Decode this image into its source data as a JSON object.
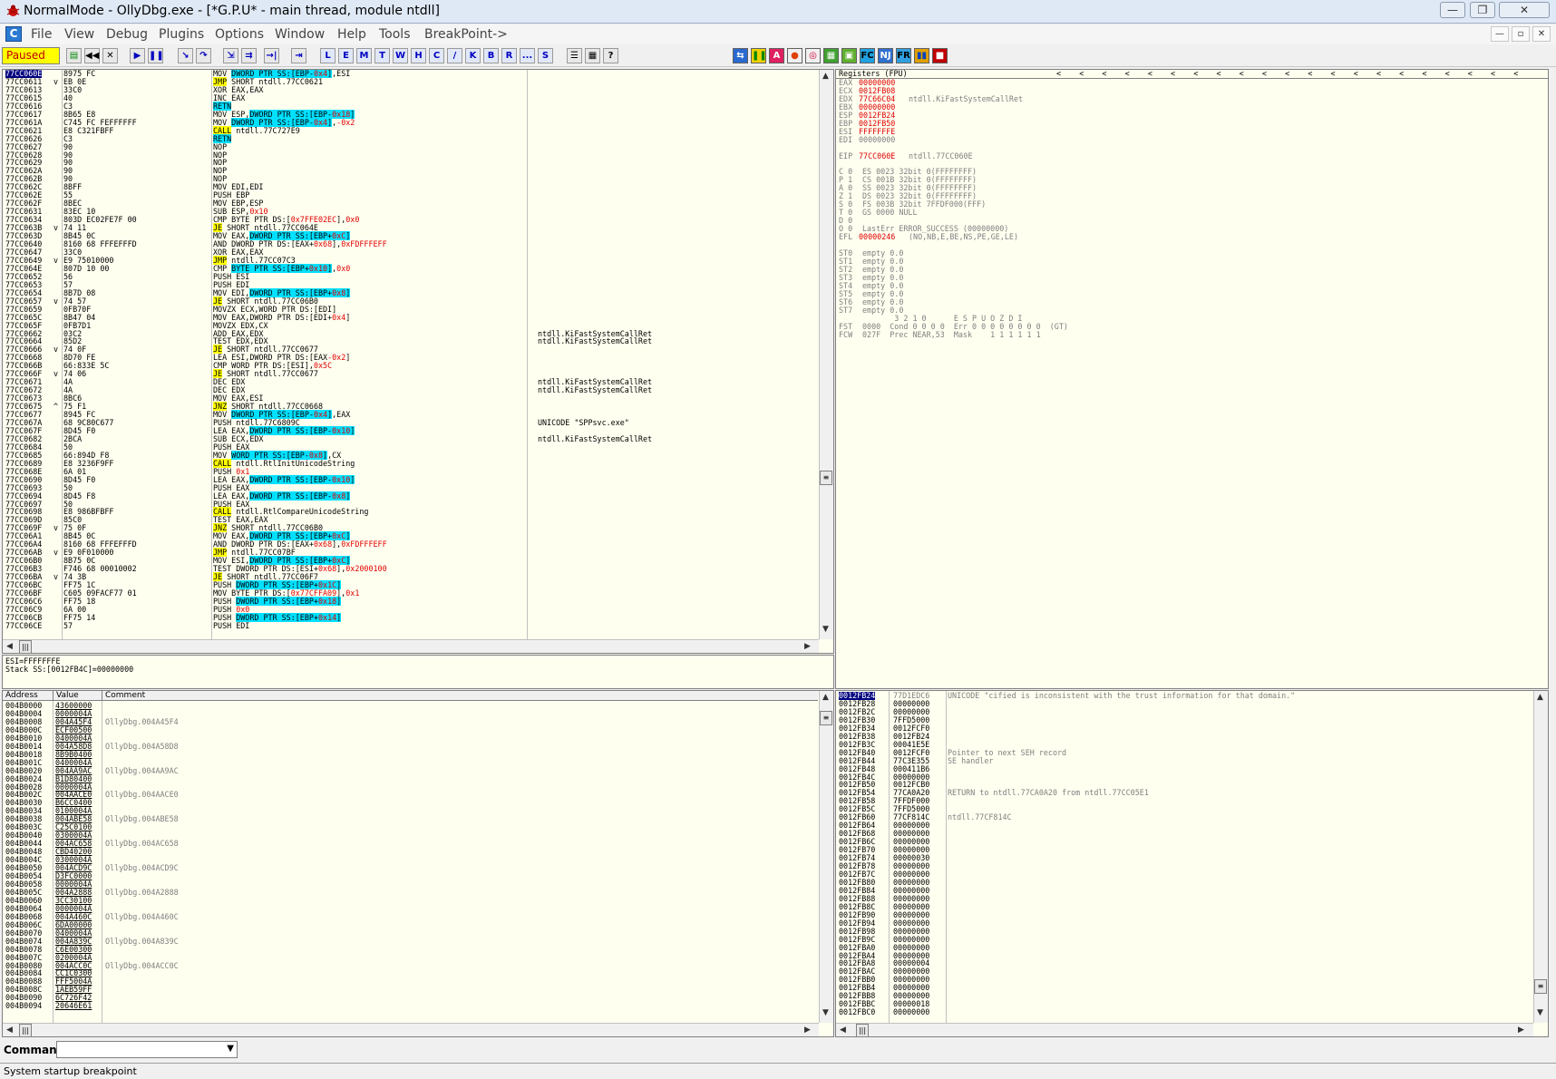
{
  "window": {
    "title": "NormalMode - OllyDbg.exe - [*G.P.U* - main thread, module ntdll]",
    "min_label": "—",
    "max_label": "❐",
    "close_label": "✕"
  },
  "menu": {
    "items": [
      "File",
      "View",
      "Debug",
      "Plugins",
      "Options",
      "Window",
      "Help",
      "Tools",
      "BreakPoint->"
    ],
    "icon_label": "C",
    "mdi_min": "—",
    "mdi_restore": "▫",
    "mdi_close": "✕"
  },
  "toolbar": {
    "status": "Paused",
    "letters": [
      "L",
      "E",
      "M",
      "T",
      "W",
      "H",
      "C",
      "/",
      "K",
      "B",
      "R",
      "...",
      "S"
    ]
  },
  "disasm": {
    "rows": [
      [
        "77CC060E",
        "8975 FC",
        "",
        "MOV DWORD PTR SS:[EBP-0x4],ESI",
        ""
      ],
      [
        "77CC0611",
        "EB 0E",
        "v",
        "JMP SHORT ntdll.77CC0621",
        ""
      ],
      [
        "77CC0613",
        "33C0",
        "",
        "XOR EAX,EAX",
        ""
      ],
      [
        "77CC0615",
        "40",
        "",
        "INC EAX",
        ""
      ],
      [
        "77CC0616",
        "C3",
        "",
        "RETN",
        ""
      ],
      [
        "77CC0617",
        "8B65 E8",
        "",
        "MOV ESP,DWORD PTR SS:[EBP-0x18]",
        ""
      ],
      [
        "77CC061A",
        "C745 FC FEFFFFFF",
        "",
        "MOV DWORD PTR SS:[EBP-0x4],-0x2",
        ""
      ],
      [
        "77CC0621",
        "E8 C321FBFF",
        "",
        "CALL ntdll.77C727E9",
        ""
      ],
      [
        "77CC0626",
        "C3",
        "",
        "RETN",
        ""
      ],
      [
        "77CC0627",
        "90",
        "",
        "NOP",
        ""
      ],
      [
        "77CC0628",
        "90",
        "",
        "NOP",
        ""
      ],
      [
        "77CC0629",
        "90",
        "",
        "NOP",
        ""
      ],
      [
        "77CC062A",
        "90",
        "",
        "NOP",
        ""
      ],
      [
        "77CC062B",
        "90",
        "",
        "NOP",
        ""
      ],
      [
        "77CC062C",
        "8BFF",
        "",
        "MOV EDI,EDI",
        ""
      ],
      [
        "77CC062E",
        "55",
        "",
        "PUSH EBP",
        ""
      ],
      [
        "77CC062F",
        "8BEC",
        "",
        "MOV EBP,ESP",
        ""
      ],
      [
        "77CC0631",
        "83EC 10",
        "",
        "SUB ESP,0x10",
        ""
      ],
      [
        "77CC0634",
        "803D EC02FE7F 00",
        "",
        "CMP BYTE PTR DS:[0x7FFE02EC],0x0",
        ""
      ],
      [
        "77CC063B",
        "74 11",
        "v",
        "JE SHORT ntdll.77CC064E",
        ""
      ],
      [
        "77CC063D",
        "8B45 0C",
        "",
        "MOV EAX,DWORD PTR SS:[EBP+0xC]",
        ""
      ],
      [
        "77CC0640",
        "8160 68 FFFEFFFD",
        "",
        "AND DWORD PTR DS:[EAX+0x68],0xFDFFFEFF",
        ""
      ],
      [
        "77CC0647",
        "33C0",
        "",
        "XOR EAX,EAX",
        ""
      ],
      [
        "77CC0649",
        "E9 75010000",
        "v",
        "JMP ntdll.77CC07C3",
        ""
      ],
      [
        "77CC064E",
        "807D 10 00",
        "",
        "CMP BYTE PTR SS:[EBP+0x10],0x0",
        ""
      ],
      [
        "77CC0652",
        "56",
        "",
        "PUSH ESI",
        ""
      ],
      [
        "77CC0653",
        "57",
        "",
        "PUSH EDI",
        ""
      ],
      [
        "77CC0654",
        "8B7D 08",
        "",
        "MOV EDI,DWORD PTR SS:[EBP+0x8]",
        ""
      ],
      [
        "77CC0657",
        "74 57",
        "v",
        "JE SHORT ntdll.77CC06B0",
        ""
      ],
      [
        "77CC0659",
        "0FB70F",
        "",
        "MOVZX ECX,WORD PTR DS:[EDI]",
        ""
      ],
      [
        "77CC065C",
        "8B47 04",
        "",
        "MOV EAX,DWORD PTR DS:[EDI+0x4]",
        ""
      ],
      [
        "77CC065F",
        "0FB7D1",
        "",
        "MOVZX EDX,CX",
        ""
      ],
      [
        "77CC0662",
        "03C2",
        "",
        "ADD EAX,EDX",
        "ntdll.KiFastSystemCallRet"
      ],
      [
        "77CC0664",
        "85D2",
        "",
        "TEST EDX,EDX",
        "ntdll.KiFastSystemCallRet"
      ],
      [
        "77CC0666",
        "74 0F",
        "v",
        "JE SHORT ntdll.77CC0677",
        ""
      ],
      [
        "77CC0668",
        "8D70 FE",
        "",
        "LEA ESI,DWORD PTR DS:[EAX-0x2]",
        ""
      ],
      [
        "77CC066B",
        "66:833E 5C",
        "",
        "CMP WORD PTR DS:[ESI],0x5C",
        ""
      ],
      [
        "77CC066F",
        "74 06",
        "v",
        "JE SHORT ntdll.77CC0677",
        ""
      ],
      [
        "77CC0671",
        "4A",
        "",
        "DEC EDX",
        "ntdll.KiFastSystemCallRet"
      ],
      [
        "77CC0672",
        "4A",
        "",
        "DEC EDX",
        "ntdll.KiFastSystemCallRet"
      ],
      [
        "77CC0673",
        "8BC6",
        "",
        "MOV EAX,ESI",
        ""
      ],
      [
        "77CC0675",
        "75 F1",
        "^",
        "JNZ SHORT ntdll.77CC0668",
        ""
      ],
      [
        "77CC0677",
        "8945 FC",
        "",
        "MOV DWORD PTR SS:[EBP-0x4],EAX",
        ""
      ],
      [
        "77CC067A",
        "68 9C80C677",
        "",
        "PUSH ntdll.77C6809C",
        "UNICODE \"SPPsvc.exe\""
      ],
      [
        "77CC067F",
        "8D45 F0",
        "",
        "LEA EAX,DWORD PTR SS:[EBP-0x10]",
        ""
      ],
      [
        "77CC0682",
        "2BCA",
        "",
        "SUB ECX,EDX",
        "ntdll.KiFastSystemCallRet"
      ],
      [
        "77CC0684",
        "50",
        "",
        "PUSH EAX",
        ""
      ],
      [
        "77CC0685",
        "66:894D F8",
        "",
        "MOV WORD PTR SS:[EBP-0x8],CX",
        ""
      ],
      [
        "77CC0689",
        "E8 3236F9FF",
        "",
        "CALL ntdll.RtlInitUnicodeString",
        ""
      ],
      [
        "77CC068E",
        "6A 01",
        "",
        "PUSH 0x1",
        ""
      ],
      [
        "77CC0690",
        "8D45 F0",
        "",
        "LEA EAX,DWORD PTR SS:[EBP-0x10]",
        ""
      ],
      [
        "77CC0693",
        "50",
        "",
        "PUSH EAX",
        ""
      ],
      [
        "77CC0694",
        "8D45 F8",
        "",
        "LEA EAX,DWORD PTR SS:[EBP-0x8]",
        ""
      ],
      [
        "77CC0697",
        "50",
        "",
        "PUSH EAX",
        ""
      ],
      [
        "77CC0698",
        "E8 986BFBFF",
        "",
        "CALL ntdll.RtlCompareUnicodeString",
        ""
      ],
      [
        "77CC069D",
        "85C0",
        "",
        "TEST EAX,EAX",
        ""
      ],
      [
        "77CC069F",
        "75 0F",
        "v",
        "JNZ SHORT ntdll.77CC06B0",
        ""
      ],
      [
        "77CC06A1",
        "8B45 0C",
        "",
        "MOV EAX,DWORD PTR SS:[EBP+0xC]",
        ""
      ],
      [
        "77CC06A4",
        "8160 68 FFFEFFFD",
        "",
        "AND DWORD PTR DS:[EAX+0x68],0xFDFFFEFF",
        ""
      ],
      [
        "77CC06AB",
        "E9 0F010000",
        "v",
        "JMP ntdll.77CC07BF",
        ""
      ],
      [
        "77CC06B0",
        "8B75 0C",
        "",
        "MOV ESI,DWORD PTR SS:[EBP+0xC]",
        ""
      ],
      [
        "77CC06B3",
        "F746 68 00010002",
        "",
        "TEST DWORD PTR DS:[ESI+0x68],0x2000100",
        ""
      ],
      [
        "77CC06BA",
        "74 3B",
        "v",
        "JE SHORT ntdll.77CC06F7",
        ""
      ],
      [
        "77CC06BC",
        "FF75 1C",
        "",
        "PUSH DWORD PTR SS:[EBP+0x1C]",
        ""
      ],
      [
        "77CC06BF",
        "C605 09FACF77 01",
        "",
        "MOV BYTE PTR DS:[0x77CFFA09],0x1",
        ""
      ],
      [
        "77CC06C6",
        "FF75 18",
        "",
        "PUSH DWORD PTR SS:[EBP+0x18]",
        ""
      ],
      [
        "77CC06C9",
        "6A 00",
        "",
        "PUSH 0x0",
        ""
      ],
      [
        "77CC06CB",
        "FF75 14",
        "",
        "PUSH DWORD PTR SS:[EBP+0x14]",
        ""
      ],
      [
        "77CC06CE",
        "57",
        "",
        "PUSH EDI",
        ""
      ]
    ]
  },
  "info": {
    "line1": "ESI=FFFFFFFE",
    "line2": "Stack SS:[0012FB4C]=00000000"
  },
  "registers": {
    "header": "Registers (FPU)",
    "rows": [
      [
        "EAX",
        "00000000",
        ""
      ],
      [
        "ECX",
        "0012FB08",
        ""
      ],
      [
        "EDX",
        "77C66C04",
        "ntdll.KiFastSystemCallRet"
      ],
      [
        "EBX",
        "00000000",
        ""
      ],
      [
        "ESP",
        "0012FB24",
        ""
      ],
      [
        "EBP",
        "0012FB50",
        ""
      ],
      [
        "ESI",
        "FFFFFFFE",
        ""
      ],
      [
        "EDI",
        "00000000",
        ""
      ],
      [
        "",
        "",
        " "
      ],
      [
        "EIP",
        "77CC060E",
        "ntdll.77CC060E"
      ],
      [
        "",
        "",
        " "
      ],
      [
        "C 0",
        "ES 0023 32bit 0(FFFFFFFF)",
        ""
      ],
      [
        "P 1",
        "CS 001B 32bit 0(FFFFFFFF)",
        ""
      ],
      [
        "A 0",
        "SS 0023 32bit 0(FFFFFFFF)",
        ""
      ],
      [
        "Z 1",
        "DS 0023 32bit 0(FFFFFFFF)",
        ""
      ],
      [
        "S 0",
        "FS 003B 32bit 7FFDF000(FFF)",
        ""
      ],
      [
        "T 0",
        "GS 0000 NULL",
        ""
      ],
      [
        "D 0",
        "",
        ""
      ],
      [
        "O 0",
        "LastErr ERROR_SUCCESS (00000000)",
        ""
      ],
      [
        "EFL",
        "00000246",
        "(NO,NB,E,BE,NS,PE,GE,LE)"
      ],
      [
        "",
        "",
        " "
      ],
      [
        "ST0",
        "empty 0.0",
        ""
      ],
      [
        "ST1",
        "empty 0.0",
        ""
      ],
      [
        "ST2",
        "empty 0.0",
        ""
      ],
      [
        "ST3",
        "empty 0.0",
        ""
      ],
      [
        "ST4",
        "empty 0.0",
        ""
      ],
      [
        "ST5",
        "empty 0.0",
        ""
      ],
      [
        "ST6",
        "empty 0.0",
        ""
      ],
      [
        "ST7",
        "empty 0.0",
        ""
      ],
      [
        "",
        "       3 2 1 0      E S P U O Z D I",
        ""
      ],
      [
        "FST",
        "0000  Cond 0 0 0 0  Err 0 0 0 0 0 0 0 0  (GT)",
        ""
      ],
      [
        "FCW",
        "027F  Prec NEAR,53  Mask    1 1 1 1 1 1",
        ""
      ]
    ]
  },
  "dump": {
    "headers": [
      "Address",
      "Value",
      "Comment"
    ],
    "rows": [
      [
        "004B0000",
        "43600000",
        ""
      ],
      [
        "004B0004",
        "0000004A",
        ""
      ],
      [
        "004B0008",
        "004A45F4",
        "OllyDbg.004A45F4"
      ],
      [
        "004B000C",
        "ECF00500",
        ""
      ],
      [
        "004B0010",
        "0400004A",
        ""
      ],
      [
        "004B0014",
        "004A58D8",
        "OllyDbg.004A58D8"
      ],
      [
        "004B0018",
        "8B9B0400",
        ""
      ],
      [
        "004B001C",
        "0400004A",
        ""
      ],
      [
        "004B0020",
        "004AA9AC",
        "OllyDbg.004AA9AC"
      ],
      [
        "004B0024",
        "B1D80400",
        ""
      ],
      [
        "004B0028",
        "0000004A",
        ""
      ],
      [
        "004B002C",
        "004AACE0",
        "OllyDbg.004AACE0"
      ],
      [
        "004B0030",
        "B6CC0400",
        ""
      ],
      [
        "004B0034",
        "0100004A",
        ""
      ],
      [
        "004B0038",
        "004ABE58",
        "OllyDbg.004ABE58"
      ],
      [
        "004B003C",
        "C25C0100",
        ""
      ],
      [
        "004B0040",
        "0300004A",
        ""
      ],
      [
        "004B0044",
        "004AC658",
        "OllyDbg.004AC658"
      ],
      [
        "004B0048",
        "CBD40200",
        ""
      ],
      [
        "004B004C",
        "0300004A",
        ""
      ],
      [
        "004B0050",
        "004ACD9C",
        "OllyDbg.004ACD9C"
      ],
      [
        "004B0054",
        "D3FC0000",
        ""
      ],
      [
        "004B0058",
        "0000004A",
        ""
      ],
      [
        "004B005C",
        "004A2888",
        "OllyDbg.004A2888"
      ],
      [
        "004B0060",
        "3CC30100",
        ""
      ],
      [
        "004B0064",
        "0000004A",
        ""
      ],
      [
        "004B0068",
        "004A460C",
        "OllyDbg.004A460C"
      ],
      [
        "004B006C",
        "6DA00000",
        ""
      ],
      [
        "004B0070",
        "0400004A",
        ""
      ],
      [
        "004B0074",
        "004A839C",
        "OllyDbg.004A839C"
      ],
      [
        "004B0078",
        "C6E00300",
        ""
      ],
      [
        "004B007C",
        "0200004A",
        ""
      ],
      [
        "004B0080",
        "004ACC0C",
        "OllyDbg.004ACC0C"
      ],
      [
        "004B0084",
        "CC1C0300",
        ""
      ],
      [
        "004B0088",
        "FFF5004A",
        ""
      ],
      [
        "004B008C",
        "1AEB59FF",
        ""
      ],
      [
        "004B0090",
        "6C726F42",
        ""
      ],
      [
        "004B0094",
        "20646E61",
        ""
      ]
    ]
  },
  "stack": {
    "rows": [
      [
        "0012FB24",
        "77D1EDC6",
        "UNICODE \"cified is inconsistent with the trust information for that domain.\r\""
      ],
      [
        "0012FB28",
        "00000000",
        ""
      ],
      [
        "0012FB2C",
        "00000000",
        ""
      ],
      [
        "0012FB30",
        "7FFD5000",
        ""
      ],
      [
        "0012FB34",
        "0012FCF0",
        ""
      ],
      [
        "0012FB38",
        "0012FB24",
        ""
      ],
      [
        "0012FB3C",
        "00041E5E",
        ""
      ],
      [
        "0012FB40",
        "0012FCF0",
        "Pointer to next SEH record"
      ],
      [
        "0012FB44",
        "77C3E355",
        "SE handler"
      ],
      [
        "0012FB48",
        "000411B6",
        ""
      ],
      [
        "0012FB4C",
        "00000000",
        ""
      ],
      [
        "0012FB50",
        "0012FCB0",
        ""
      ],
      [
        "0012FB54",
        "77CA0A20",
        "RETURN to ntdll.77CA0A20 from ntdll.77CC05E1"
      ],
      [
        "0012FB58",
        "7FFDF000",
        ""
      ],
      [
        "0012FB5C",
        "7FFD5000",
        ""
      ],
      [
        "0012FB60",
        "77CF814C",
        "ntdll.77CF814C"
      ],
      [
        "0012FB64",
        "00000000",
        ""
      ],
      [
        "0012FB68",
        "00000000",
        ""
      ],
      [
        "0012FB6C",
        "00000000",
        ""
      ],
      [
        "0012FB70",
        "00000000",
        ""
      ],
      [
        "0012FB74",
        "00000030",
        ""
      ],
      [
        "0012FB78",
        "00000000",
        ""
      ],
      [
        "0012FB7C",
        "00000000",
        ""
      ],
      [
        "0012FB80",
        "00000000",
        ""
      ],
      [
        "0012FB84",
        "00000000",
        ""
      ],
      [
        "0012FB88",
        "00000000",
        ""
      ],
      [
        "0012FB8C",
        "00000000",
        ""
      ],
      [
        "0012FB90",
        "00000000",
        ""
      ],
      [
        "0012FB94",
        "00000000",
        ""
      ],
      [
        "0012FB98",
        "00000000",
        ""
      ],
      [
        "0012FB9C",
        "00000000",
        ""
      ],
      [
        "0012FBA0",
        "00000000",
        ""
      ],
      [
        "0012FBA4",
        "00000000",
        ""
      ],
      [
        "0012FBA8",
        "00000004",
        ""
      ],
      [
        "0012FBAC",
        "00000000",
        ""
      ],
      [
        "0012FBB0",
        "00000000",
        ""
      ],
      [
        "0012FBB4",
        "00000000",
        ""
      ],
      [
        "0012FBB8",
        "00000000",
        ""
      ],
      [
        "0012FBBC",
        "00000018",
        ""
      ],
      [
        "0012FBC0",
        "00000000",
        ""
      ]
    ]
  },
  "command": {
    "label": "Command",
    "value": ""
  },
  "status": {
    "text": "System startup breakpoint"
  }
}
